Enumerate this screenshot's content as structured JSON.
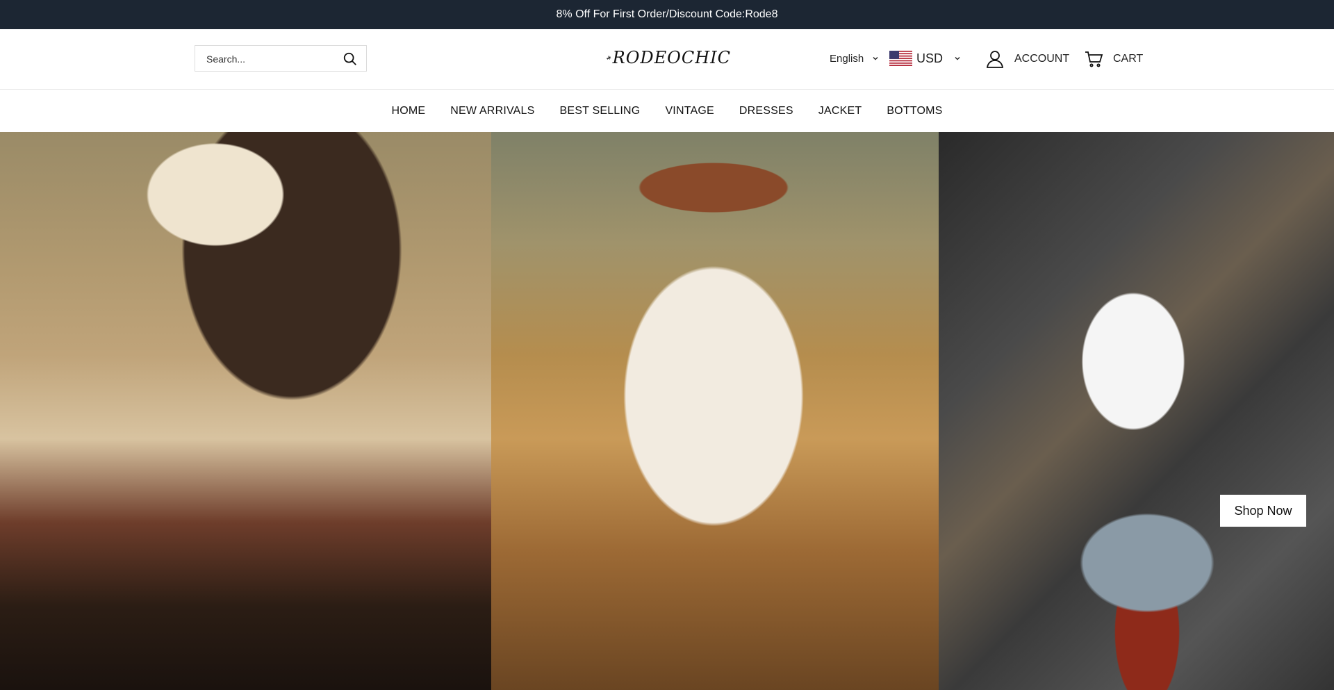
{
  "announcement": {
    "text": "8% Off For First Order/Discount Code:Rode8"
  },
  "header": {
    "search": {
      "placeholder": "Search..."
    },
    "logo": {
      "text": "RODEOCHIC"
    },
    "language": {
      "selected": "English"
    },
    "currency": {
      "selected": "USD"
    },
    "account": {
      "label": "ACCOUNT"
    },
    "cart": {
      "label": "CART"
    }
  },
  "nav": {
    "items": [
      {
        "label": "HOME"
      },
      {
        "label": "NEW ARRIVALS"
      },
      {
        "label": "BEST SELLING"
      },
      {
        "label": "VINTAGE"
      },
      {
        "label": "DRESSES"
      },
      {
        "label": "JACKET"
      },
      {
        "label": "BOTTOMS"
      }
    ]
  },
  "hero": {
    "cta_label": "Shop Now"
  },
  "colors": {
    "announcement_bg": "#1c2633",
    "announcement_text": "#ffffff",
    "nav_text": "#111111"
  }
}
